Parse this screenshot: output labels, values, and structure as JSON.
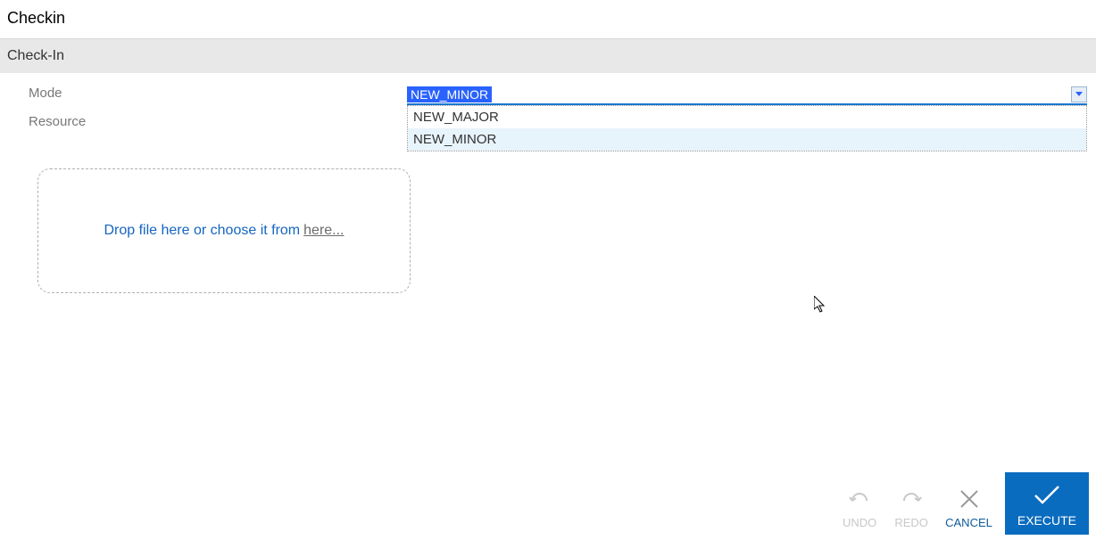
{
  "page": {
    "title": "Checkin",
    "section_title": "Check-In"
  },
  "labels": {
    "mode": "Mode",
    "resource": "Resource"
  },
  "mode_select": {
    "selected": "NEW_MINOR",
    "options": [
      "NEW_MAJOR",
      "NEW_MINOR"
    ]
  },
  "dropzone": {
    "prefix": "Drop file here or choose it from",
    "link": "here..."
  },
  "footer": {
    "undo": "UNDO",
    "redo": "REDO",
    "cancel": "CANCEL",
    "execute": "EXECUTE"
  }
}
